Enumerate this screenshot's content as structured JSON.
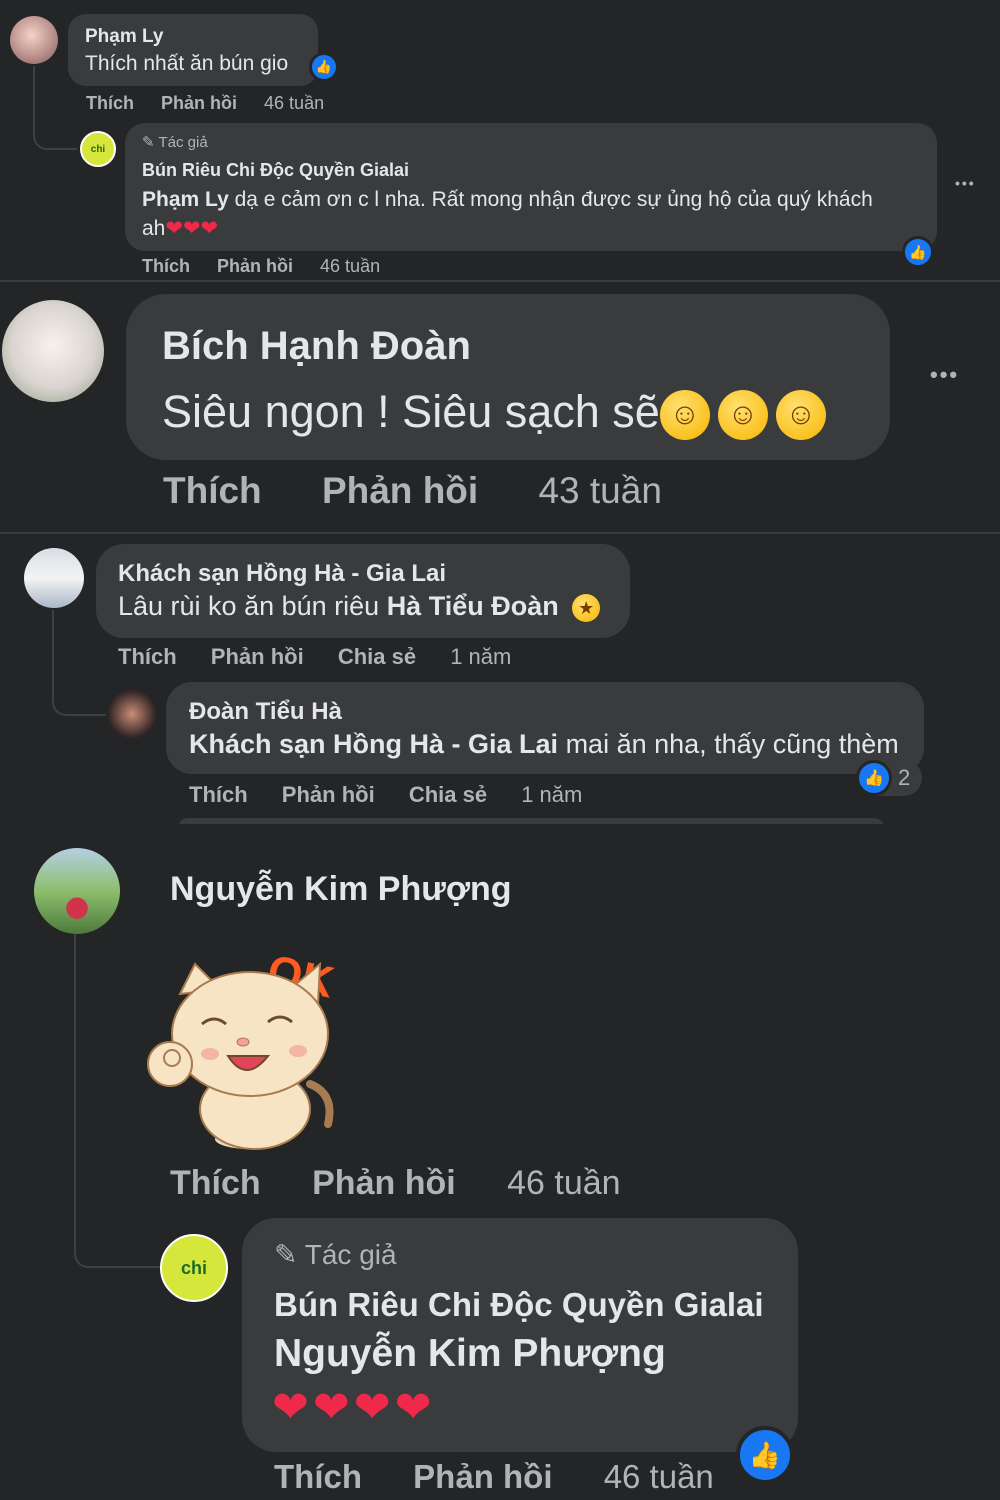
{
  "c1": {
    "name": "Phạm Ly",
    "text": "Thích nhất ăn bún gio",
    "like": "Thích",
    "reply": "Phản hồi",
    "time": "46 tuần",
    "reply1": {
      "badge": "Tác giả",
      "name": "Bún Riêu Chi Độc Quyền Gialai",
      "mention": "Phạm Ly",
      "text": " dạ e cảm ơn c l nha. Rất mong nhận được sự ủng hộ của quý khách",
      "text2": "ah",
      "like": "Thích",
      "reply": "Phản hồi",
      "time": "46 tuần",
      "more": "•••"
    }
  },
  "c2": {
    "name": "Bích Hạnh Đoàn",
    "text": "Siêu ngon ! Siêu sạch sẽ",
    "like": "Thích",
    "reply": "Phản hồi",
    "time": "43 tuần",
    "more": "•••"
  },
  "c3": {
    "name": "Khách sạn Hồng Hà - Gia Lai",
    "text": "Lâu rùi ko ăn bún riêu ",
    "mention": "Hà Tiểu Đoàn",
    "like": "Thích",
    "reply": "Phản hồi",
    "share": "Chia sẻ",
    "time": "1 năm",
    "reply1": {
      "name": "Đoàn Tiểu Hà",
      "mention": "Khách sạn Hồng Hà - Gia Lai",
      "text": " mai ăn nha, thấy cũng thèm",
      "reactions": "2",
      "like": "Thích",
      "reply": "Phản hồi",
      "share": "Chia sẻ",
      "time": "1 năm"
    }
  },
  "c4": {
    "name": "Nguyễn Kim Phượng",
    "sticker_text": "OK",
    "like": "Thích",
    "reply": "Phản hồi",
    "time": "46 tuần",
    "reply1": {
      "badge": "Tác giả",
      "name": "Bún Riêu Chi Độc Quyền Gialai",
      "mention": "Nguyễn Kim Phượng",
      "like": "Thích",
      "reply": "Phản hồi",
      "time": "46 tuần"
    }
  },
  "logo_text": "chi",
  "colors": {
    "background": "#242526",
    "bubble": "#3a3b3c",
    "like_blue": "#1877f2",
    "heart": "#f02849"
  }
}
